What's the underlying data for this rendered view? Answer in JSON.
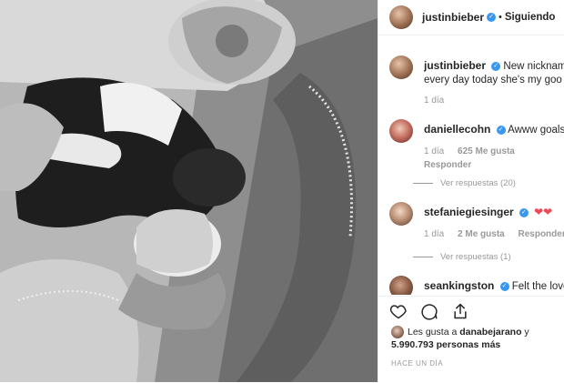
{
  "header": {
    "username": "justinbieber",
    "verified_mark": "✓",
    "separator": "•",
    "follow_status": "Siguiendo"
  },
  "caption": {
    "username": "justinbieber",
    "text": "New nickname fo",
    "text_line2": "every day today she's my goo go",
    "time": "1 día"
  },
  "comments": [
    {
      "username": "daniellecohn",
      "text": "Awww goals",
      "time": "1 día",
      "likes": "625 Me gusta",
      "reply": "Responder",
      "view_replies": "Ver respuestas (20)"
    },
    {
      "username": "stefaniegiesinger",
      "text": "",
      "time": "1 día",
      "likes": "2 Me gusta",
      "reply": "Responder",
      "view_replies": "Ver respuestas (1)"
    },
    {
      "username": "seankingston",
      "text": "Felt the love"
    }
  ],
  "actions": {
    "icons": [
      "heart-icon",
      "comment-icon",
      "share-icon"
    ]
  },
  "likes": {
    "prefix": "Les gusta a",
    "user": "danabejarano",
    "connector": "y",
    "count": "5.990.793",
    "suffix": "personas más"
  },
  "timestamp": "HACE UN DÍA",
  "colors": {
    "verified": "#3897f0",
    "heart": "#ed4956",
    "muted": "#999999",
    "text": "#262626"
  }
}
